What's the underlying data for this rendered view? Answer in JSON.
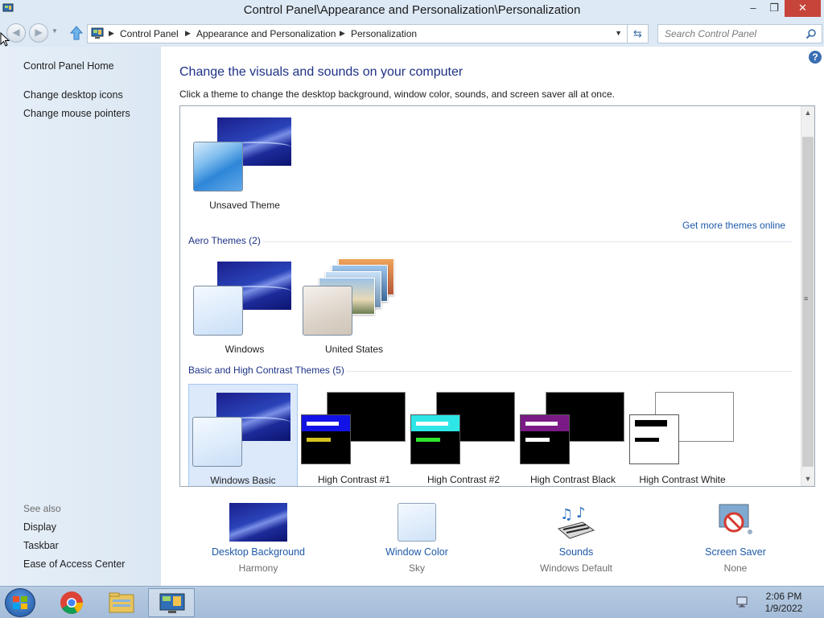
{
  "window": {
    "title": "Control Panel\\Appearance and Personalization\\Personalization",
    "minimize_glyph": "–",
    "maximize_glyph": "❐",
    "close_glyph": "✕"
  },
  "address_bar": {
    "breadcrumbs": [
      "Control Panel",
      "Appearance and Personalization",
      "Personalization"
    ],
    "search_placeholder": "Search Control Panel"
  },
  "sidebar": {
    "home": "Control Panel Home",
    "links": [
      "Change desktop icons",
      "Change mouse pointers"
    ],
    "see_also_heading": "See also",
    "see_also": [
      "Display",
      "Taskbar",
      "Ease of Access Center"
    ]
  },
  "main": {
    "title": "Change the visuals and sounds on your computer",
    "description": "Click a theme to change the desktop background, window color, sounds, and screen saver all at once.",
    "more_themes_link": "Get more themes online",
    "my_themes": [
      {
        "name": "Unsaved Theme"
      }
    ],
    "aero_heading": "Aero Themes (2)",
    "aero_themes": [
      {
        "name": "Windows"
      },
      {
        "name": "United States"
      }
    ],
    "basic_heading": "Basic and High Contrast Themes (5)",
    "basic_themes": [
      {
        "name": "Windows Basic",
        "selected": true
      },
      {
        "name": "High Contrast #1"
      },
      {
        "name": "High Contrast #2"
      },
      {
        "name": "High Contrast Black"
      },
      {
        "name": "High Contrast White"
      }
    ]
  },
  "settings": [
    {
      "label": "Desktop Background",
      "value": "Harmony"
    },
    {
      "label": "Window Color",
      "value": "Sky"
    },
    {
      "label": "Sounds",
      "value": "Windows Default"
    },
    {
      "label": "Screen Saver",
      "value": "None"
    }
  ],
  "taskbar": {
    "time": "2:06 PM",
    "date": "1/9/2022"
  },
  "colors": {
    "link": "#1e5aa8",
    "heading": "#1e3287",
    "close_button": "#c7443a",
    "selection": "#dbe9fb"
  }
}
